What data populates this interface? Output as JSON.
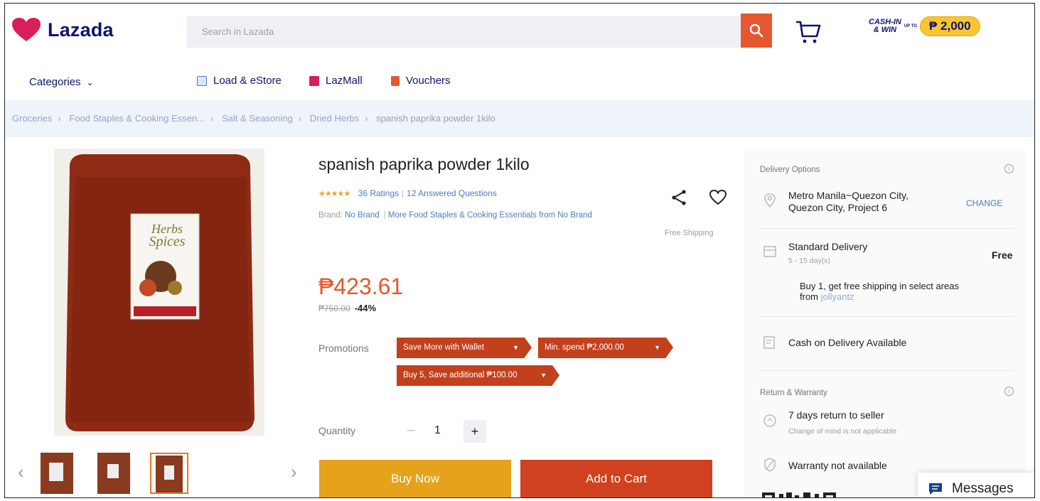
{
  "header": {
    "logo_text": "Lazada",
    "search_placeholder": "Search in Lazada",
    "cashin_line1": "CASH-IN",
    "cashin_line2": "& WIN",
    "cashin_upto": "UP TO",
    "cashin_amount": "₱ 2,000"
  },
  "nav": {
    "categories": "Categories",
    "items": [
      "Load & eStore",
      "LazMall",
      "Vouchers"
    ]
  },
  "breadcrumb": [
    "Groceries",
    "Food Staples & Cooking Essen...",
    "Salt & Seasoning",
    "Dried Herbs",
    "spanish paprika powder 1kilo"
  ],
  "product": {
    "title": "spanish paprika powder 1kilo",
    "rating_value": 4.5,
    "ratings": "36 Ratings",
    "answered": "12 Answered Questions",
    "brand_label": "Brand:",
    "brand": "No Brand",
    "more_from": "More Food Staples & Cooking Essentials from No Brand",
    "free_shipping": "Free Shipping",
    "price": "₱423.61",
    "old_price": "₱750.00",
    "discount": "-44%",
    "promotions_label": "Promotions",
    "promotions": [
      "Save More with Wallet",
      "Min. spend ₱2,000.00",
      "Buy 5, Save additional ₱100.00"
    ],
    "quantity_label": "Quantity",
    "quantity_minus": "−",
    "quantity": "1",
    "quantity_plus": "+",
    "buy_now": "Buy Now",
    "add_to_cart": "Add to Cart",
    "image_label_1": "Herbs",
    "image_label_2": "Spices"
  },
  "delivery": {
    "heading": "Delivery Options",
    "location_line1": "Metro Manila~Quezon City,",
    "location_line2": "Quezon City, Project 6",
    "change": "CHANGE",
    "standard": "Standard Delivery",
    "standard_days": "5 - 15 day(s)",
    "standard_price": "Free",
    "promo_line1": "Buy 1, get free shipping in select areas",
    "promo_from": "from",
    "promo_seller": "jollyantz",
    "cod": "Cash on Delivery Available"
  },
  "warranty": {
    "heading": "Return & Warranty",
    "return_title": "7 days return to seller",
    "return_sub": "Change of mind is not applicable",
    "warranty": "Warranty not available"
  },
  "messages": "Messages",
  "colors": {
    "brand_navy": "#0f136d",
    "accent_orange": "#e5572f",
    "buy_now": "#e6a21b",
    "add_to_cart": "#d0411f",
    "promo_tag": "#c2401c"
  }
}
